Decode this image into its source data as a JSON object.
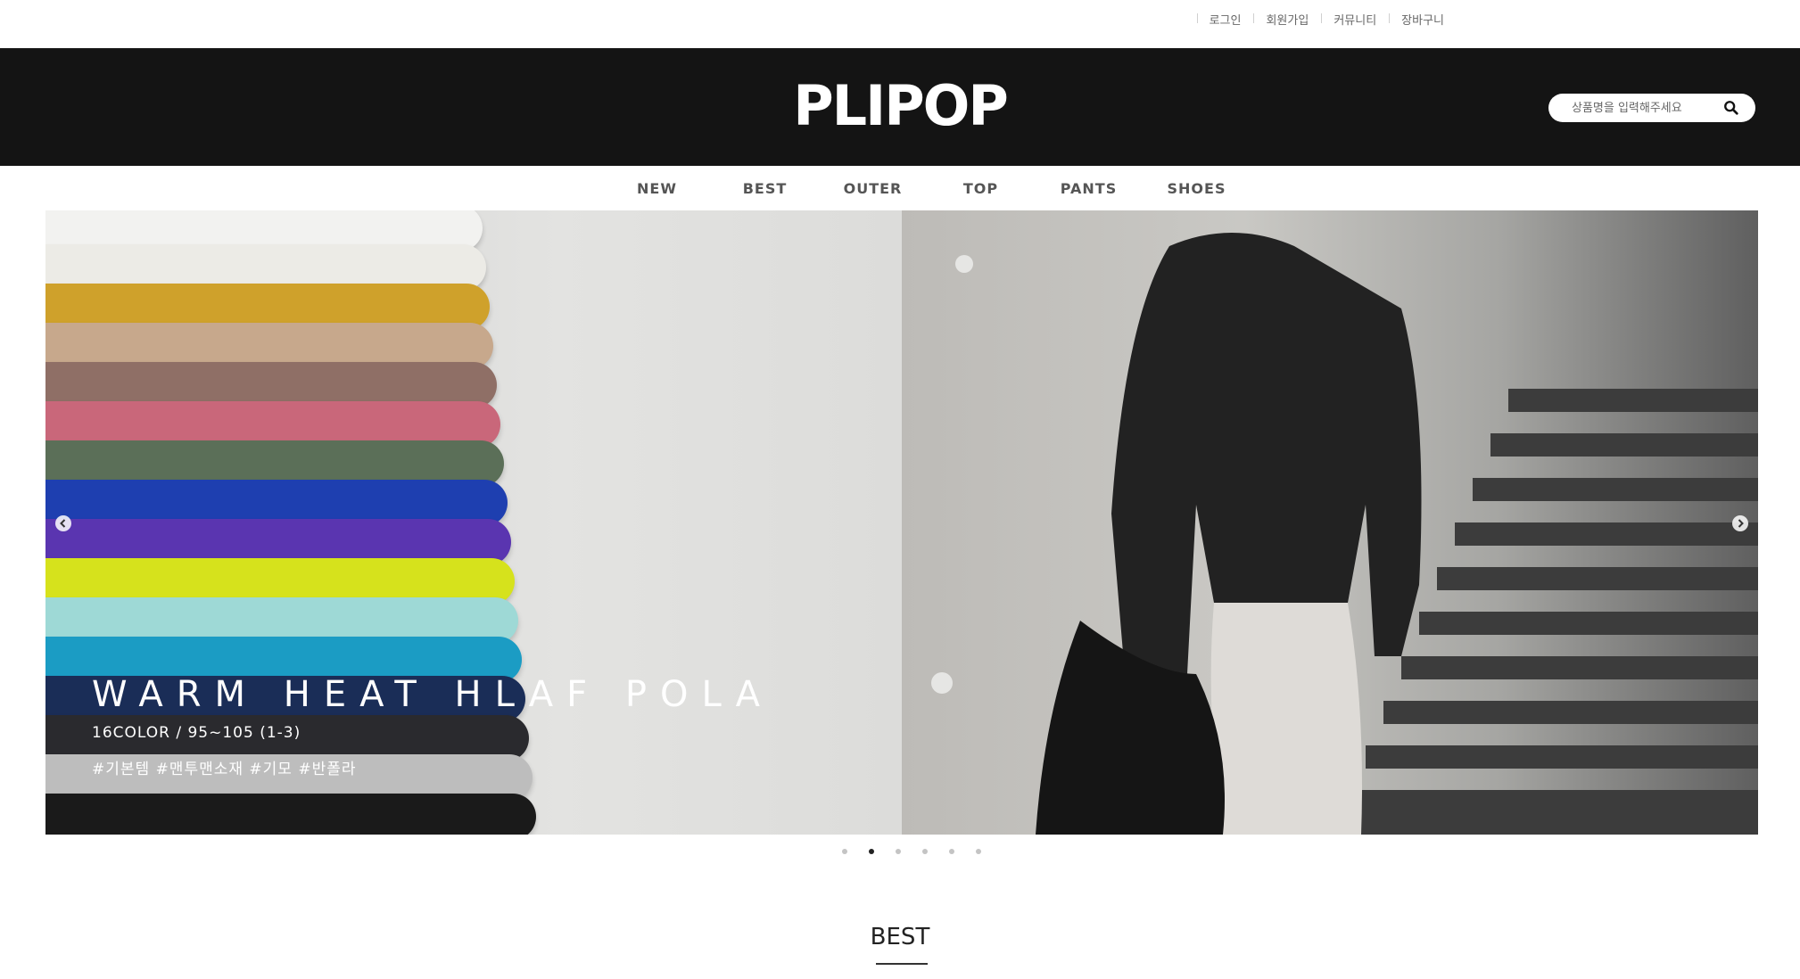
{
  "util_menu": [
    "로그인",
    "회원가입",
    "커뮤니티",
    "장바구니"
  ],
  "header": {
    "logo": "PLIPOP"
  },
  "search": {
    "placeholder": "상품명을 입력해주세요",
    "icon": "search-icon"
  },
  "nav": [
    "NEW",
    "BEST",
    "OUTER",
    "TOP",
    "PANTS",
    "SHOES"
  ],
  "banner": {
    "title": "WARM HEAT HLAF POLA",
    "subtitle": "16COLOR / 95~105 (1-3)",
    "tags": "#기본템 #맨투맨소재 #기모 #반폴라",
    "prev_icon": "chevron-left-icon",
    "next_icon": "chevron-right-icon",
    "slide_count": 6,
    "active_slide": 2,
    "fold_colors": [
      "#f2f2f0",
      "#ecebe6",
      "#cfa12b",
      "#c7a88c",
      "#8f6f66",
      "#c9677a",
      "#5b6f58",
      "#1e3fb0",
      "#5a35b0",
      "#d6e21c",
      "#9ed9d6",
      "#1b9cc4",
      "#1a2d57",
      "#2a2a2e",
      "#bdbdbd",
      "#1a1a1a"
    ]
  },
  "section": {
    "best_title": "BEST"
  }
}
